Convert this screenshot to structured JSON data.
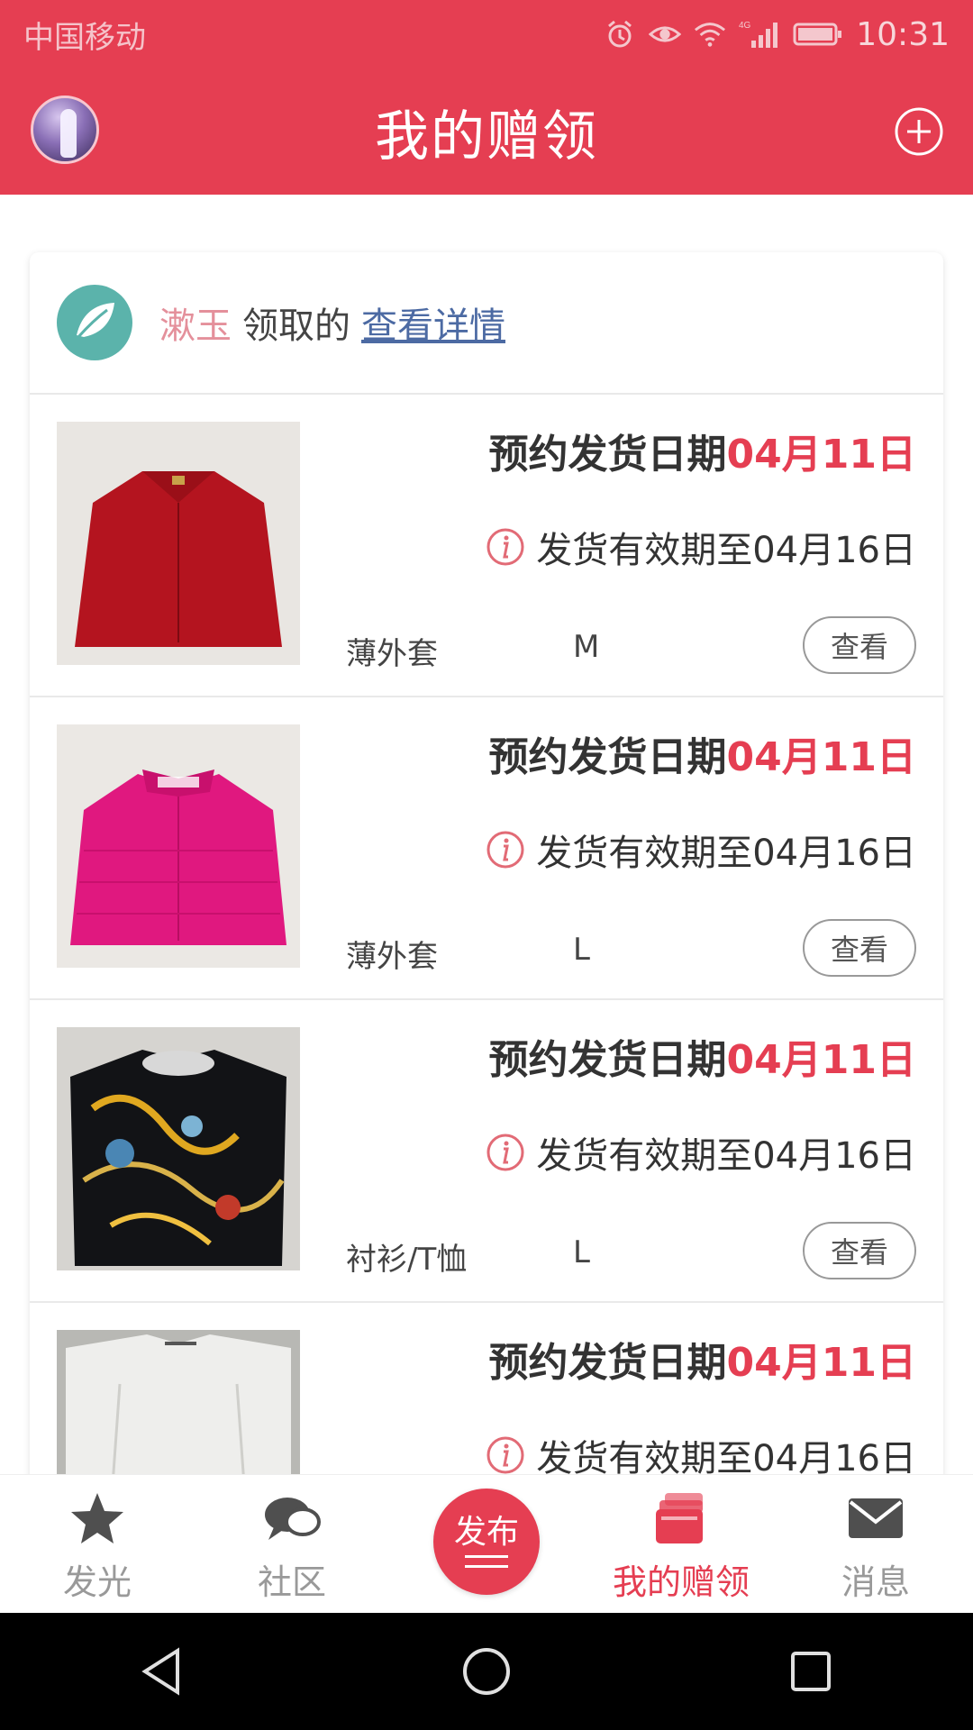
{
  "status_bar": {
    "carrier": "中国移动",
    "network_badge": "4G",
    "time": "10:31",
    "icons": [
      "alarm-icon",
      "eye-icon",
      "wifi-icon",
      "signal-icon",
      "battery-icon"
    ]
  },
  "header": {
    "title": "我的赠领",
    "left_icon": "avatar",
    "right_icon": "add-circle-icon",
    "brand_color": "#e53e52"
  },
  "receipt": {
    "receiver_name": "漱玉",
    "action_text": "领取的",
    "details_link": "查看详情"
  },
  "items": [
    {
      "ship_label": "预约发货日期",
      "ship_date": "04月11日",
      "valid_text": "发货有效期至04月16日",
      "category": "薄外套",
      "size": "M",
      "view_label": "查看",
      "thumb_color": "#b4141f"
    },
    {
      "ship_label": "预约发货日期",
      "ship_date": "04月11日",
      "valid_text": "发货有效期至04月16日",
      "category": "薄外套",
      "size": "L",
      "view_label": "查看",
      "thumb_color": "#e0187f"
    },
    {
      "ship_label": "预约发货日期",
      "ship_date": "04月11日",
      "valid_text": "发货有效期至04月16日",
      "category": "衬衫/T恤",
      "size": "L",
      "view_label": "查看",
      "thumb_color": "#1a1a1a"
    },
    {
      "ship_label": "预约发货日期",
      "ship_date": "04月11日",
      "valid_text": "发货有效期至04月16日",
      "category": "",
      "size": "",
      "view_label": "",
      "thumb_color": "#eeeeec"
    }
  ],
  "bottom_nav": {
    "items": [
      {
        "label": "发光",
        "icon": "star-icon",
        "active": false
      },
      {
        "label": "社区",
        "icon": "chat-bubbles-icon",
        "active": false
      },
      {
        "label": "我的赠领",
        "icon": "wallet-icon",
        "active": true
      },
      {
        "label": "消息",
        "icon": "mail-icon",
        "active": false
      }
    ],
    "publish": {
      "label": "发布",
      "icon": "menu-lines-icon"
    }
  },
  "system_nav": {
    "buttons": [
      "back-icon",
      "home-icon",
      "recents-icon"
    ]
  }
}
